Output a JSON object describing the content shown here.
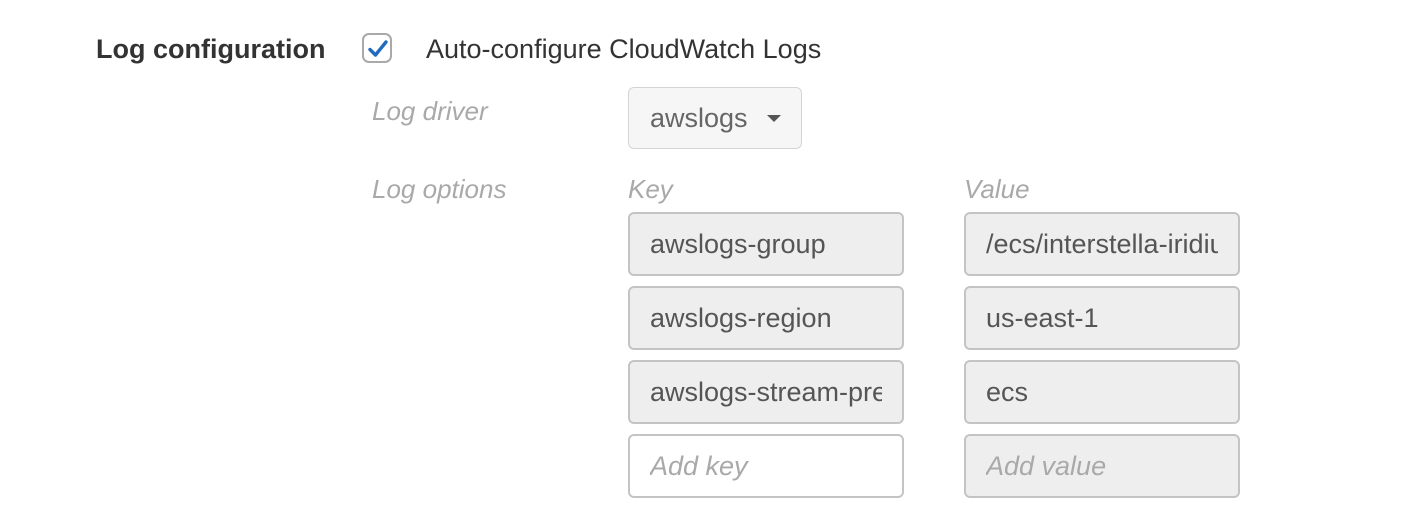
{
  "section": {
    "title": "Log configuration"
  },
  "auto_configure": {
    "checked": true,
    "label": "Auto-configure CloudWatch Logs"
  },
  "log_driver": {
    "label": "Log driver",
    "selected": "awslogs"
  },
  "log_options": {
    "label": "Log options",
    "key_header": "Key",
    "value_header": "Value",
    "rows": [
      {
        "key": "awslogs-group",
        "value": "/ecs/interstella-iridium"
      },
      {
        "key": "awslogs-region",
        "value": "us-east-1"
      },
      {
        "key": "awslogs-stream-prefix",
        "value": "ecs"
      }
    ],
    "add_key_placeholder": "Add key",
    "add_value_placeholder": "Add value"
  },
  "colors": {
    "checkmark": "#1f6bbf",
    "label_muted": "#a9a9a9",
    "readonly_field_bg": "#eeeeee"
  }
}
